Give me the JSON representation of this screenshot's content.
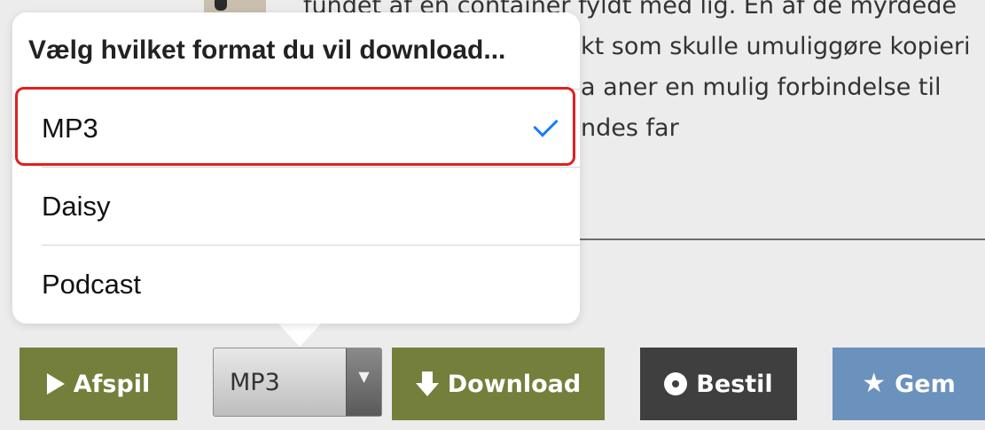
{
  "background": {
    "description_lines": [
      "fundet af en container fyldt med lig. En af de myrdede",
      "kt som skulle umuliggøre kopieri",
      "a aner en mulig forbindelse til",
      "ndes far"
    ]
  },
  "popover": {
    "title": "Vælg hvilket format du vil download...",
    "options": [
      {
        "label": "MP3",
        "selected": true
      },
      {
        "label": "Daisy",
        "selected": false
      },
      {
        "label": "Podcast",
        "selected": false
      }
    ],
    "check_color": "#1a7cf5",
    "highlight_color": "#e02020"
  },
  "actions": {
    "play_label": "Afspil",
    "format_value": "MP3",
    "download_label": "Download",
    "order_label": "Bestil",
    "save_label": "Gem"
  },
  "colors": {
    "green": "#737f3b",
    "dark": "#3f3f3f",
    "blue": "#6b91bd"
  }
}
